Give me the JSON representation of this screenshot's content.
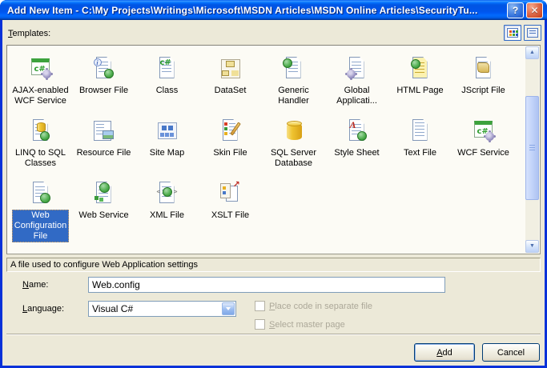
{
  "window": {
    "title": "Add New Item - C:\\My Projects\\Writings\\Microsoft\\MSDN Articles\\MSDN Online Articles\\SecurityTu...",
    "controls": {
      "help": "?",
      "close": "✕"
    }
  },
  "colors": {
    "titlebar_blue": "#0054E3",
    "dialog_border": "#0831D9",
    "dialog_bg": "#ECE9D8",
    "list_bg": "#FCFBF5",
    "selection": "#316AC5",
    "disabled_text": "#ACA899",
    "input_border": "#7F9DB9"
  },
  "templates": {
    "label": {
      "text": "Templates:",
      "accel": "T"
    },
    "view_buttons": [
      {
        "name": "large-icons-view",
        "selected": true
      },
      {
        "name": "list-view",
        "selected": false
      }
    ],
    "description": "A file used to configure Web Application settings",
    "items": [
      {
        "label": "AJAX-enabled WCF Service",
        "lines": [
          "AJAX-enabled",
          "WCF Service"
        ],
        "icon": "ajax-wcf-service",
        "selected": false
      },
      {
        "label": "Browser File",
        "lines": [
          "Browser File"
        ],
        "icon": "browser-file",
        "selected": false
      },
      {
        "label": "Class",
        "lines": [
          "Class"
        ],
        "icon": "class",
        "selected": false
      },
      {
        "label": "DataSet",
        "lines": [
          "DataSet"
        ],
        "icon": "dataset",
        "selected": false
      },
      {
        "label": "Generic Handler",
        "lines": [
          "Generic",
          "Handler"
        ],
        "icon": "generic-handler",
        "selected": false
      },
      {
        "label": "Global Applicati...",
        "lines": [
          "Global",
          "Applicati..."
        ],
        "icon": "global-application",
        "selected": false
      },
      {
        "label": "HTML Page",
        "lines": [
          "HTML Page"
        ],
        "icon": "html-page",
        "selected": false
      },
      {
        "label": "JScript File",
        "lines": [
          "JScript File"
        ],
        "icon": "jscript-file",
        "selected": false
      },
      {
        "label": "LINQ to SQL Classes",
        "lines": [
          "LINQ to SQL",
          "Classes"
        ],
        "icon": "linq-to-sql",
        "selected": false
      },
      {
        "label": "Resource File",
        "lines": [
          "Resource File"
        ],
        "icon": "resource-file",
        "selected": false
      },
      {
        "label": "Site Map",
        "lines": [
          "Site Map"
        ],
        "icon": "site-map",
        "selected": false
      },
      {
        "label": "Skin File",
        "lines": [
          "Skin File"
        ],
        "icon": "skin-file",
        "selected": false
      },
      {
        "label": "SQL Server Database",
        "lines": [
          "SQL Server",
          "Database"
        ],
        "icon": "sql-server-database",
        "selected": false
      },
      {
        "label": "Style Sheet",
        "lines": [
          "Style Sheet"
        ],
        "icon": "style-sheet",
        "selected": false
      },
      {
        "label": "Text File",
        "lines": [
          "Text File"
        ],
        "icon": "text-file",
        "selected": false
      },
      {
        "label": "WCF Service",
        "lines": [
          "WCF Service"
        ],
        "icon": "wcf-service",
        "selected": false
      },
      {
        "label": "Web Configuration File",
        "lines": [
          "Web",
          "Configuration",
          "File"
        ],
        "icon": "web-configuration-file",
        "selected": true
      },
      {
        "label": "Web Service",
        "lines": [
          "Web Service"
        ],
        "icon": "web-service",
        "selected": false
      },
      {
        "label": "XML File",
        "lines": [
          "XML File"
        ],
        "icon": "xml-file",
        "selected": false
      },
      {
        "label": "XSLT File",
        "lines": [
          "XSLT File"
        ],
        "icon": "xslt-file",
        "selected": false
      }
    ]
  },
  "scrollbar": {
    "up": "▲",
    "down": "▼"
  },
  "form": {
    "name": {
      "label": {
        "text": "Name:",
        "accel": "N"
      },
      "value": "Web.config"
    },
    "language": {
      "label": {
        "text": "Language:",
        "accel": "L"
      },
      "value": "Visual C#"
    },
    "options": [
      {
        "text": "Place code in separate file",
        "accel": "P",
        "checked": false,
        "disabled": true
      },
      {
        "text": "Select master page",
        "accel": "S",
        "checked": false,
        "disabled": true
      }
    ]
  },
  "actions": {
    "add": {
      "text": "Add",
      "accel": "A"
    },
    "cancel": {
      "text": "Cancel",
      "accel": ""
    }
  }
}
